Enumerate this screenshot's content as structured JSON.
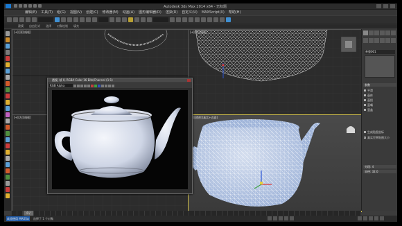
{
  "window": {
    "title": "Autodesk 3ds Max 2014 x64 - 无标题"
  },
  "menu": {
    "items": [
      "编辑(E)",
      "工具(T)",
      "组(G)",
      "视图(V)",
      "创建(C)",
      "修改器(M)",
      "动画(A)",
      "图形编辑器(D)",
      "渲染(R)",
      "自定义(U)",
      "MAXScript(X)",
      "帮助(H)"
    ]
  },
  "ribbon": {
    "tabs": [
      "建模",
      "自由形式",
      "选择",
      "对象绘制",
      "填充"
    ]
  },
  "viewports": {
    "top_label": "[+][顶][线框]",
    "front_label": "[+][前][线框]",
    "left_label": "[+][左][线框]",
    "persp_label": "[+][透视][真实+边面]"
  },
  "frame_buffer": {
    "title": "透视, 帧 0, RGBA Color 16 Bits/Channel (1:1)",
    "channel_select": "RGB Alpha"
  },
  "command_panel": {
    "object_name": "茶壶001",
    "param_header": "参数",
    "checkbox_labels": [
      "平滑",
      "壶体",
      "壶把",
      "壶嘴",
      "壶盖"
    ],
    "section_labels": [
      "生成贴图坐标",
      "真实世界贴图大小"
    ],
    "bottom_labels": [
      "分段: 4",
      "半径: 32.0"
    ]
  },
  "timeline": {
    "frame": "0 / 100"
  },
  "statusbar": {
    "welcome": "欢迎使用 MAXScr",
    "status": "选择了 1 个对象"
  },
  "colors": {
    "accent": "#1a7ad4",
    "active_viewport_border": "#d2c14a"
  }
}
